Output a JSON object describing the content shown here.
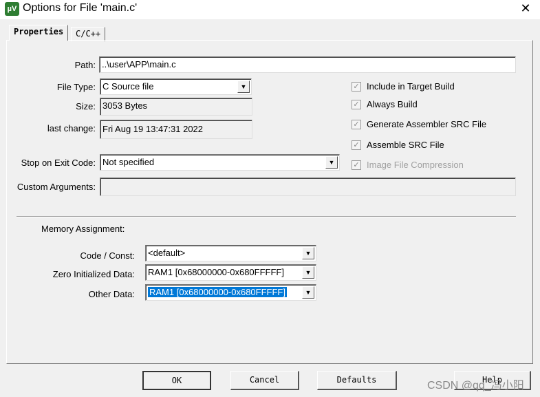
{
  "window": {
    "title": "Options for File 'main.c'",
    "icon": "keil-uvision-icon",
    "close": "✕"
  },
  "tabs": [
    {
      "label": "Properties",
      "active": true
    },
    {
      "label": "C/C++",
      "active": false
    }
  ],
  "fields": {
    "path": {
      "label": "Path:",
      "value": "..\\user\\APP\\main.c"
    },
    "file_type": {
      "label": "File Type:",
      "value": "C Source file"
    },
    "size": {
      "label": "Size:",
      "value": "3053 Bytes"
    },
    "last_change": {
      "label": "last change:",
      "value": "Fri Aug 19 13:47:31 2022"
    },
    "stop_on_exit": {
      "label": "Stop on Exit Code:",
      "value": "Not specified"
    },
    "custom_args": {
      "label": "Custom Arguments:",
      "value": ""
    }
  },
  "checkboxes": [
    {
      "label": "Include in Target Build",
      "checked": true,
      "enabled": true
    },
    {
      "label": "Always Build",
      "checked": true,
      "enabled": true
    },
    {
      "label": "Generate Assembler SRC File",
      "checked": true,
      "enabled": true
    },
    {
      "label": "Assemble SRC File",
      "checked": true,
      "enabled": true
    },
    {
      "label": "Image File Compression",
      "checked": true,
      "enabled": false
    }
  ],
  "memory": {
    "title": "Memory Assignment:",
    "code_const": {
      "label": "Code / Const:",
      "value": "<default>"
    },
    "zero_init": {
      "label": "Zero Initialized Data:",
      "value": "RAM1 [0x68000000-0x680FFFFF]"
    },
    "other": {
      "label": "Other Data:",
      "value": "RAM1 [0x68000000-0x680FFFFF]"
    }
  },
  "buttons": {
    "ok": "OK",
    "cancel": "Cancel",
    "defaults": "Defaults",
    "help": "Help"
  },
  "watermark": "CSDN @qq_冯小阳",
  "colors": {
    "selection": "#0078d7"
  }
}
